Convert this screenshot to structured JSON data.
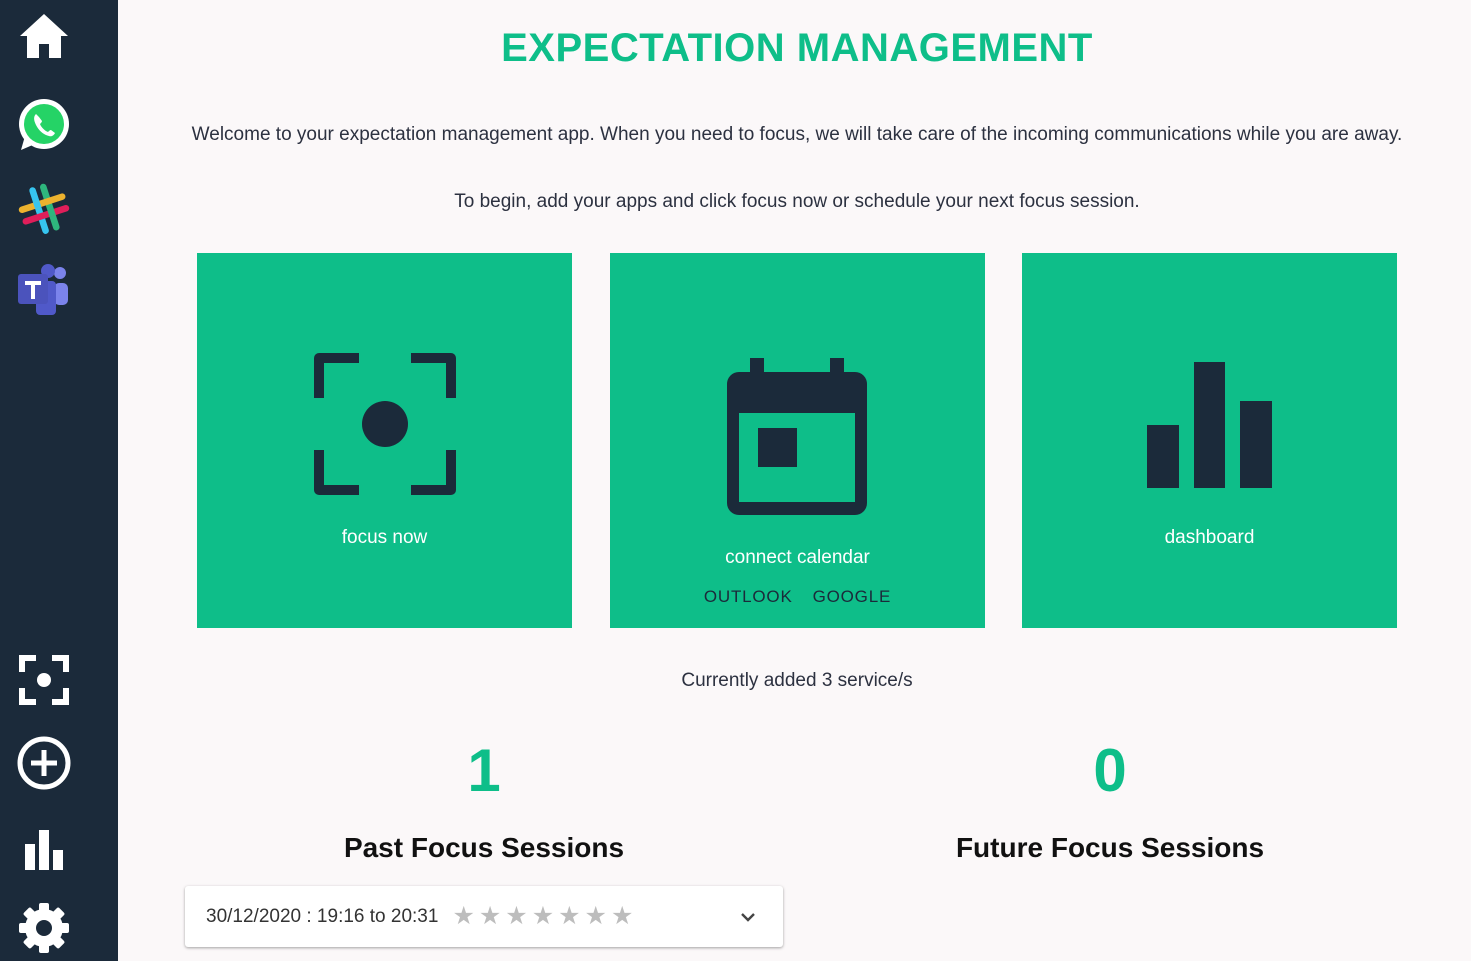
{
  "sidebar": {
    "top_items": [
      {
        "name": "home-icon",
        "label": "Home"
      },
      {
        "name": "whatsapp-icon",
        "label": "WhatsApp"
      },
      {
        "name": "slack-icon",
        "label": "Slack"
      },
      {
        "name": "teams-icon",
        "label": "Microsoft Teams"
      }
    ],
    "bottom_items": [
      {
        "name": "focus-icon",
        "label": "Focus"
      },
      {
        "name": "add-circle-icon",
        "label": "Add app"
      },
      {
        "name": "bar-chart-icon",
        "label": "Dashboard"
      },
      {
        "name": "gear-icon",
        "label": "Settings"
      }
    ]
  },
  "header": {
    "title": "EXPECTATION MANAGEMENT"
  },
  "intro": {
    "line1": "Welcome to your expectation management app. When you need to focus, we will take care of the incoming communications while you are away.",
    "line2": "To begin, add your apps and click focus now or schedule your next focus session."
  },
  "cards": {
    "focus": {
      "label": "focus now",
      "icon": "focus-icon"
    },
    "calendar": {
      "label": "connect calendar",
      "icon": "calendar-icon",
      "links": [
        "OUTLOOK",
        "GOOGLE"
      ]
    },
    "dashboard": {
      "label": "dashboard",
      "icon": "bar-chart-icon"
    }
  },
  "services_text": "Currently added 3 service/s",
  "stats": {
    "past": {
      "count": "1",
      "label": "Past Focus Sessions"
    },
    "future": {
      "count": "0",
      "label": "Future Focus Sessions"
    }
  },
  "past_sessions": [
    {
      "range": "30/12/2020 : 19:16 to 20:31",
      "rating": 0,
      "max_rating": 7
    }
  ],
  "colors": {
    "accent": "#0ebe89",
    "sidebar": "#1b2a3a",
    "background": "#fbf8f9",
    "icon_dark": "#1b2a3a",
    "star_empty": "#bdbdbd"
  }
}
